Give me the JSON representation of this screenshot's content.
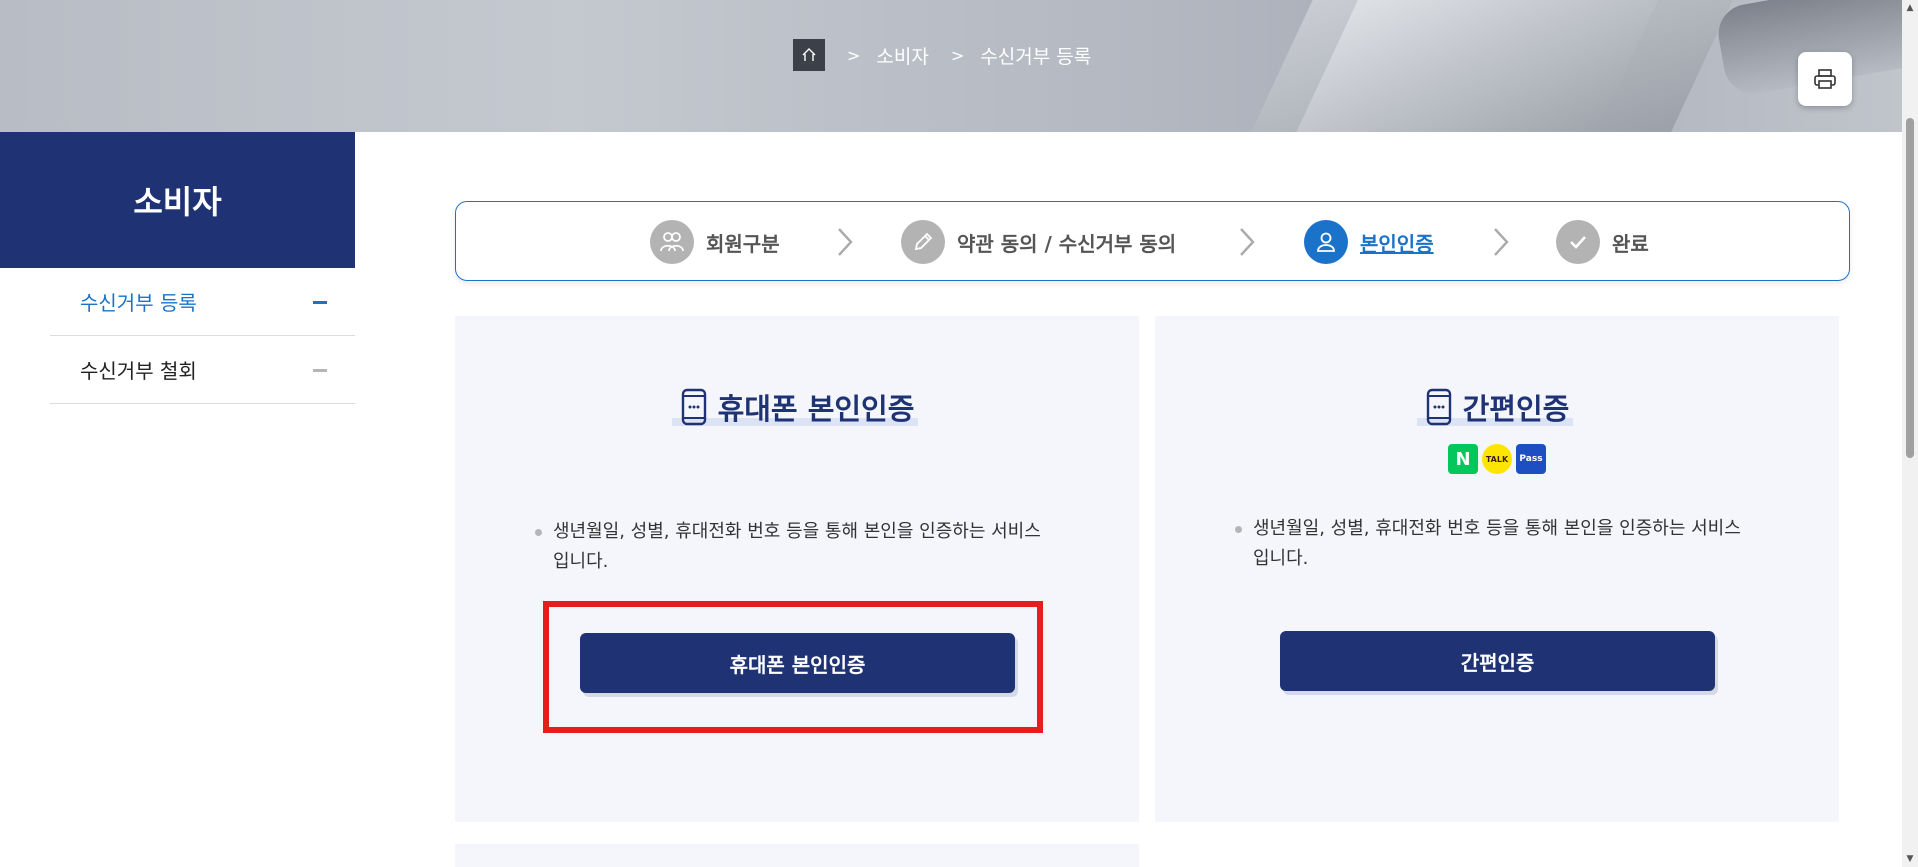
{
  "breadcrumb": {
    "items": [
      "소비자",
      "수신거부 등록"
    ]
  },
  "sidebar": {
    "title": "소비자",
    "items": [
      {
        "label": "수신거부 등록",
        "active": true
      },
      {
        "label": "수신거부 철회",
        "active": false
      }
    ]
  },
  "stepper": {
    "steps": [
      {
        "label": "회원구분",
        "icon": "members-icon"
      },
      {
        "label": "약관 동의 / 수신거부 동의",
        "icon": "pencil-icon"
      },
      {
        "label": "본인인증",
        "icon": "person-icon",
        "active": true
      },
      {
        "label": "완료",
        "icon": "check-icon"
      }
    ]
  },
  "cards": {
    "phone": {
      "title": "휴대폰 본인인증",
      "description": "생년월일, 성별, 휴대전화 번호 등을 통해 본인을 인증하는 서비스입니다.",
      "button": "휴대폰 본인인증"
    },
    "simple": {
      "title": "간편인증",
      "logos": [
        "N",
        "TALK",
        "Pass"
      ],
      "description": "생년월일, 성별, 휴대전화 번호 등을 통해 본인을 인증하는 서비스입니다.",
      "button": "간편인증"
    }
  },
  "colors": {
    "brand_navy": "#1f3374",
    "accent_blue": "#1a73c8",
    "highlight_red": "#e41e1e",
    "card_bg": "#f4f6fb"
  }
}
